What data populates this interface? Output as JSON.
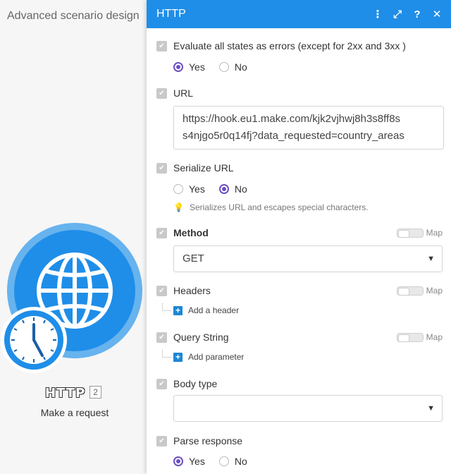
{
  "canvas": {
    "scenario_title": "Advanced scenario design",
    "module": {
      "name": "HTTP",
      "id": "2",
      "description": "Make a request",
      "icon": "globe-icon",
      "badge_icon": "clock-icon",
      "color": "#1f8ee8"
    }
  },
  "panel": {
    "title": "HTTP",
    "header_icons": [
      "more-vertical-icon",
      "expand-icon",
      "help-icon",
      "close-icon"
    ],
    "header_symbols": {
      "more": "⋮",
      "expand": "⤢",
      "help": "?",
      "close": "✕"
    },
    "fields": {
      "evaluate": {
        "label": "Evaluate all states as errors (except for 2xx and 3xx )",
        "options": [
          "Yes",
          "No"
        ],
        "selected": "Yes"
      },
      "url": {
        "label": "URL",
        "value_line1": "https://hook.eu1.make.com/kjk2vjhwj8h3s8ff8s",
        "value_line2": "s4njgo5r0q14fj?data_requested=country_areas"
      },
      "serialize_url": {
        "label": "Serialize URL",
        "options": [
          "Yes",
          "No"
        ],
        "selected": "No",
        "hint": "Serializes URL and escapes special characters."
      },
      "method": {
        "label": "Method",
        "value": "GET",
        "map_label": "Map"
      },
      "headers": {
        "label": "Headers",
        "map_label": "Map",
        "add_label": "Add a header"
      },
      "query_string": {
        "label": "Query String",
        "map_label": "Map",
        "add_label": "Add parameter"
      },
      "body_type": {
        "label": "Body type",
        "value": ""
      },
      "parse_response": {
        "label": "Parse response",
        "options": [
          "Yes",
          "No"
        ],
        "selected": "Yes"
      }
    }
  },
  "colors": {
    "accent": "#1f8ee8",
    "radio": "#6d4fc1",
    "add_icon": "#1a87d6"
  }
}
